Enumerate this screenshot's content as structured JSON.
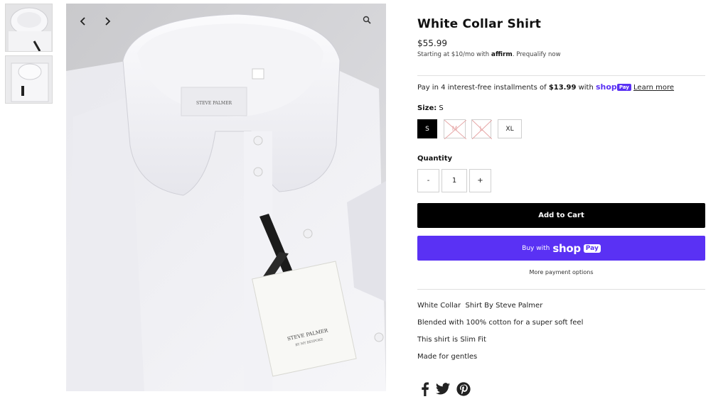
{
  "product": {
    "title": "White Collar Shirt",
    "price": "$55.99",
    "affirm": {
      "prefix": "Starting at $10/mo with",
      "logo": "affirm",
      "link": "Prequalify now"
    },
    "installments": {
      "prefix": "Pay in 4 interest-free installments of",
      "amount": "$13.99",
      "with": "with",
      "shop_word": "shop",
      "pay_pill": "Pay",
      "learn_more": "Learn more"
    },
    "size": {
      "label": "Size:",
      "selected": "S",
      "options": [
        {
          "label": "S",
          "state": "selected"
        },
        {
          "label": "M",
          "state": "unavailable"
        },
        {
          "label": "L",
          "state": "unavailable"
        },
        {
          "label": "XL",
          "state": "available"
        }
      ]
    },
    "quantity": {
      "label": "Quantity",
      "minus": "-",
      "value": "1",
      "plus": "+"
    },
    "add_to_cart": "Add to Cart",
    "buy_with": {
      "prefix": "Buy with",
      "shop": "shop",
      "pay": "Pay"
    },
    "more_payment_options": "More payment options",
    "description": [
      "White Collar  Shirt By Steve Palmer",
      "Blended with 100% cotton for a super soft feel",
      "This shirt is Slim Fit",
      "Made for gentles"
    ]
  },
  "gallery": {
    "thumbnails": [
      "thumbnail-collar",
      "thumbnail-folded-shirt"
    ],
    "icons": [
      "chevron-left-icon",
      "chevron-right-icon",
      "zoom-icon"
    ],
    "label_brand": "STEVE PALMER",
    "tag_brand": "STEVE PALMER",
    "tag_sub": "BY MY BESPOKE"
  },
  "social": [
    "facebook-icon",
    "twitter-icon",
    "pinterest-icon"
  ],
  "colors": {
    "shop_purple": "#5a31f4",
    "button_black": "#000000",
    "unavailable_red": "#e7a9a9"
  }
}
